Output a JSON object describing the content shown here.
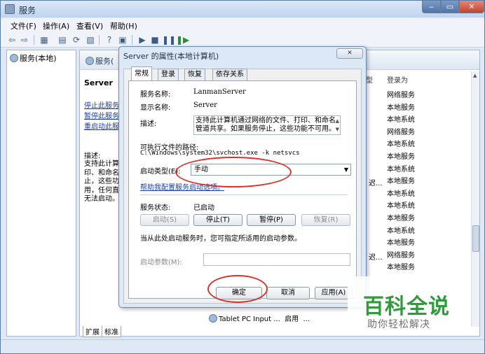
{
  "window": {
    "title": "服务"
  },
  "menu": [
    "文件(F)",
    "操作(A)",
    "查看(V)",
    "帮助(H)"
  ],
  "tree": {
    "root": "服务(本地)"
  },
  "right": {
    "header": "服务(",
    "service_name": "Server",
    "links": [
      "停止此服务",
      "暂停此服务",
      "重启动此服务"
    ],
    "desc_label": "描述:",
    "desc_text": "支持此计算机通过网络的文件、打印、和命名管道共享。如果服务停止，这些功能不可用。如果服务被禁用，任何直接依赖于此服务的服务将无法启动。",
    "desc_visible_lines": [
      "支持此计算",
      "印、和命名",
      "止，这些功",
      "用，任何直",
      "无法启动。"
    ],
    "col_startup_partial": "型",
    "col_logon": "登录为",
    "logon": [
      "网络服务",
      "本地服务",
      "本地系统",
      "网络服务",
      "本地系统",
      "本地服务",
      "本地系统",
      "本地服务",
      "本地系统",
      "本地系统",
      "本地服务",
      "本地系统",
      "本地服务",
      "网络服务",
      "本地服务"
    ],
    "startup_partial_1": "迟...",
    "startup_partial_2": "迟...",
    "bottom_row": {
      "name": "Tablet PC Input ...",
      "status": "启用",
      "type": "..."
    },
    "tabs": [
      "扩展",
      "标准"
    ]
  },
  "dialog": {
    "title": "Server 的属性(本地计算机)",
    "close": "✕",
    "tabs": [
      "常规",
      "登录",
      "恢复",
      "依存关系"
    ],
    "service_name_label": "服务名称:",
    "service_name": "LanmanServer",
    "display_name_label": "显示名称:",
    "display_name": "Server",
    "description_label": "描述:",
    "description": "支持此计算机通过网络的文件、打印、和命名管道共享。如果服务停止，这些功能不可用。",
    "exe_label": "可执行文件的路径:",
    "exe_path": "C:\\Windows\\system32\\svchost.exe -k netsvcs",
    "startup_label": "启动类型(E):",
    "startup_value": "手动",
    "help_link": "帮助我配置服务启动选项。",
    "status_label": "服务状态:",
    "status_value": "已启动",
    "buttons": {
      "start": "启动(S)",
      "stop": "停止(T)",
      "pause": "暂停(P)",
      "resume": "恢复(R)"
    },
    "hint": "当从此处启动服务时，您可指定所适用的启动参数。",
    "param_label": "启动参数(M):",
    "ok": "确定",
    "cancel": "取消",
    "apply": "应用(A)"
  },
  "watermark": {
    "main": "百科全说",
    "sub": "助你轻松解决"
  },
  "colors": {
    "annotation": "#d9342b",
    "watermark_green": "#2f9c3b",
    "link": "#1a3fa6"
  }
}
